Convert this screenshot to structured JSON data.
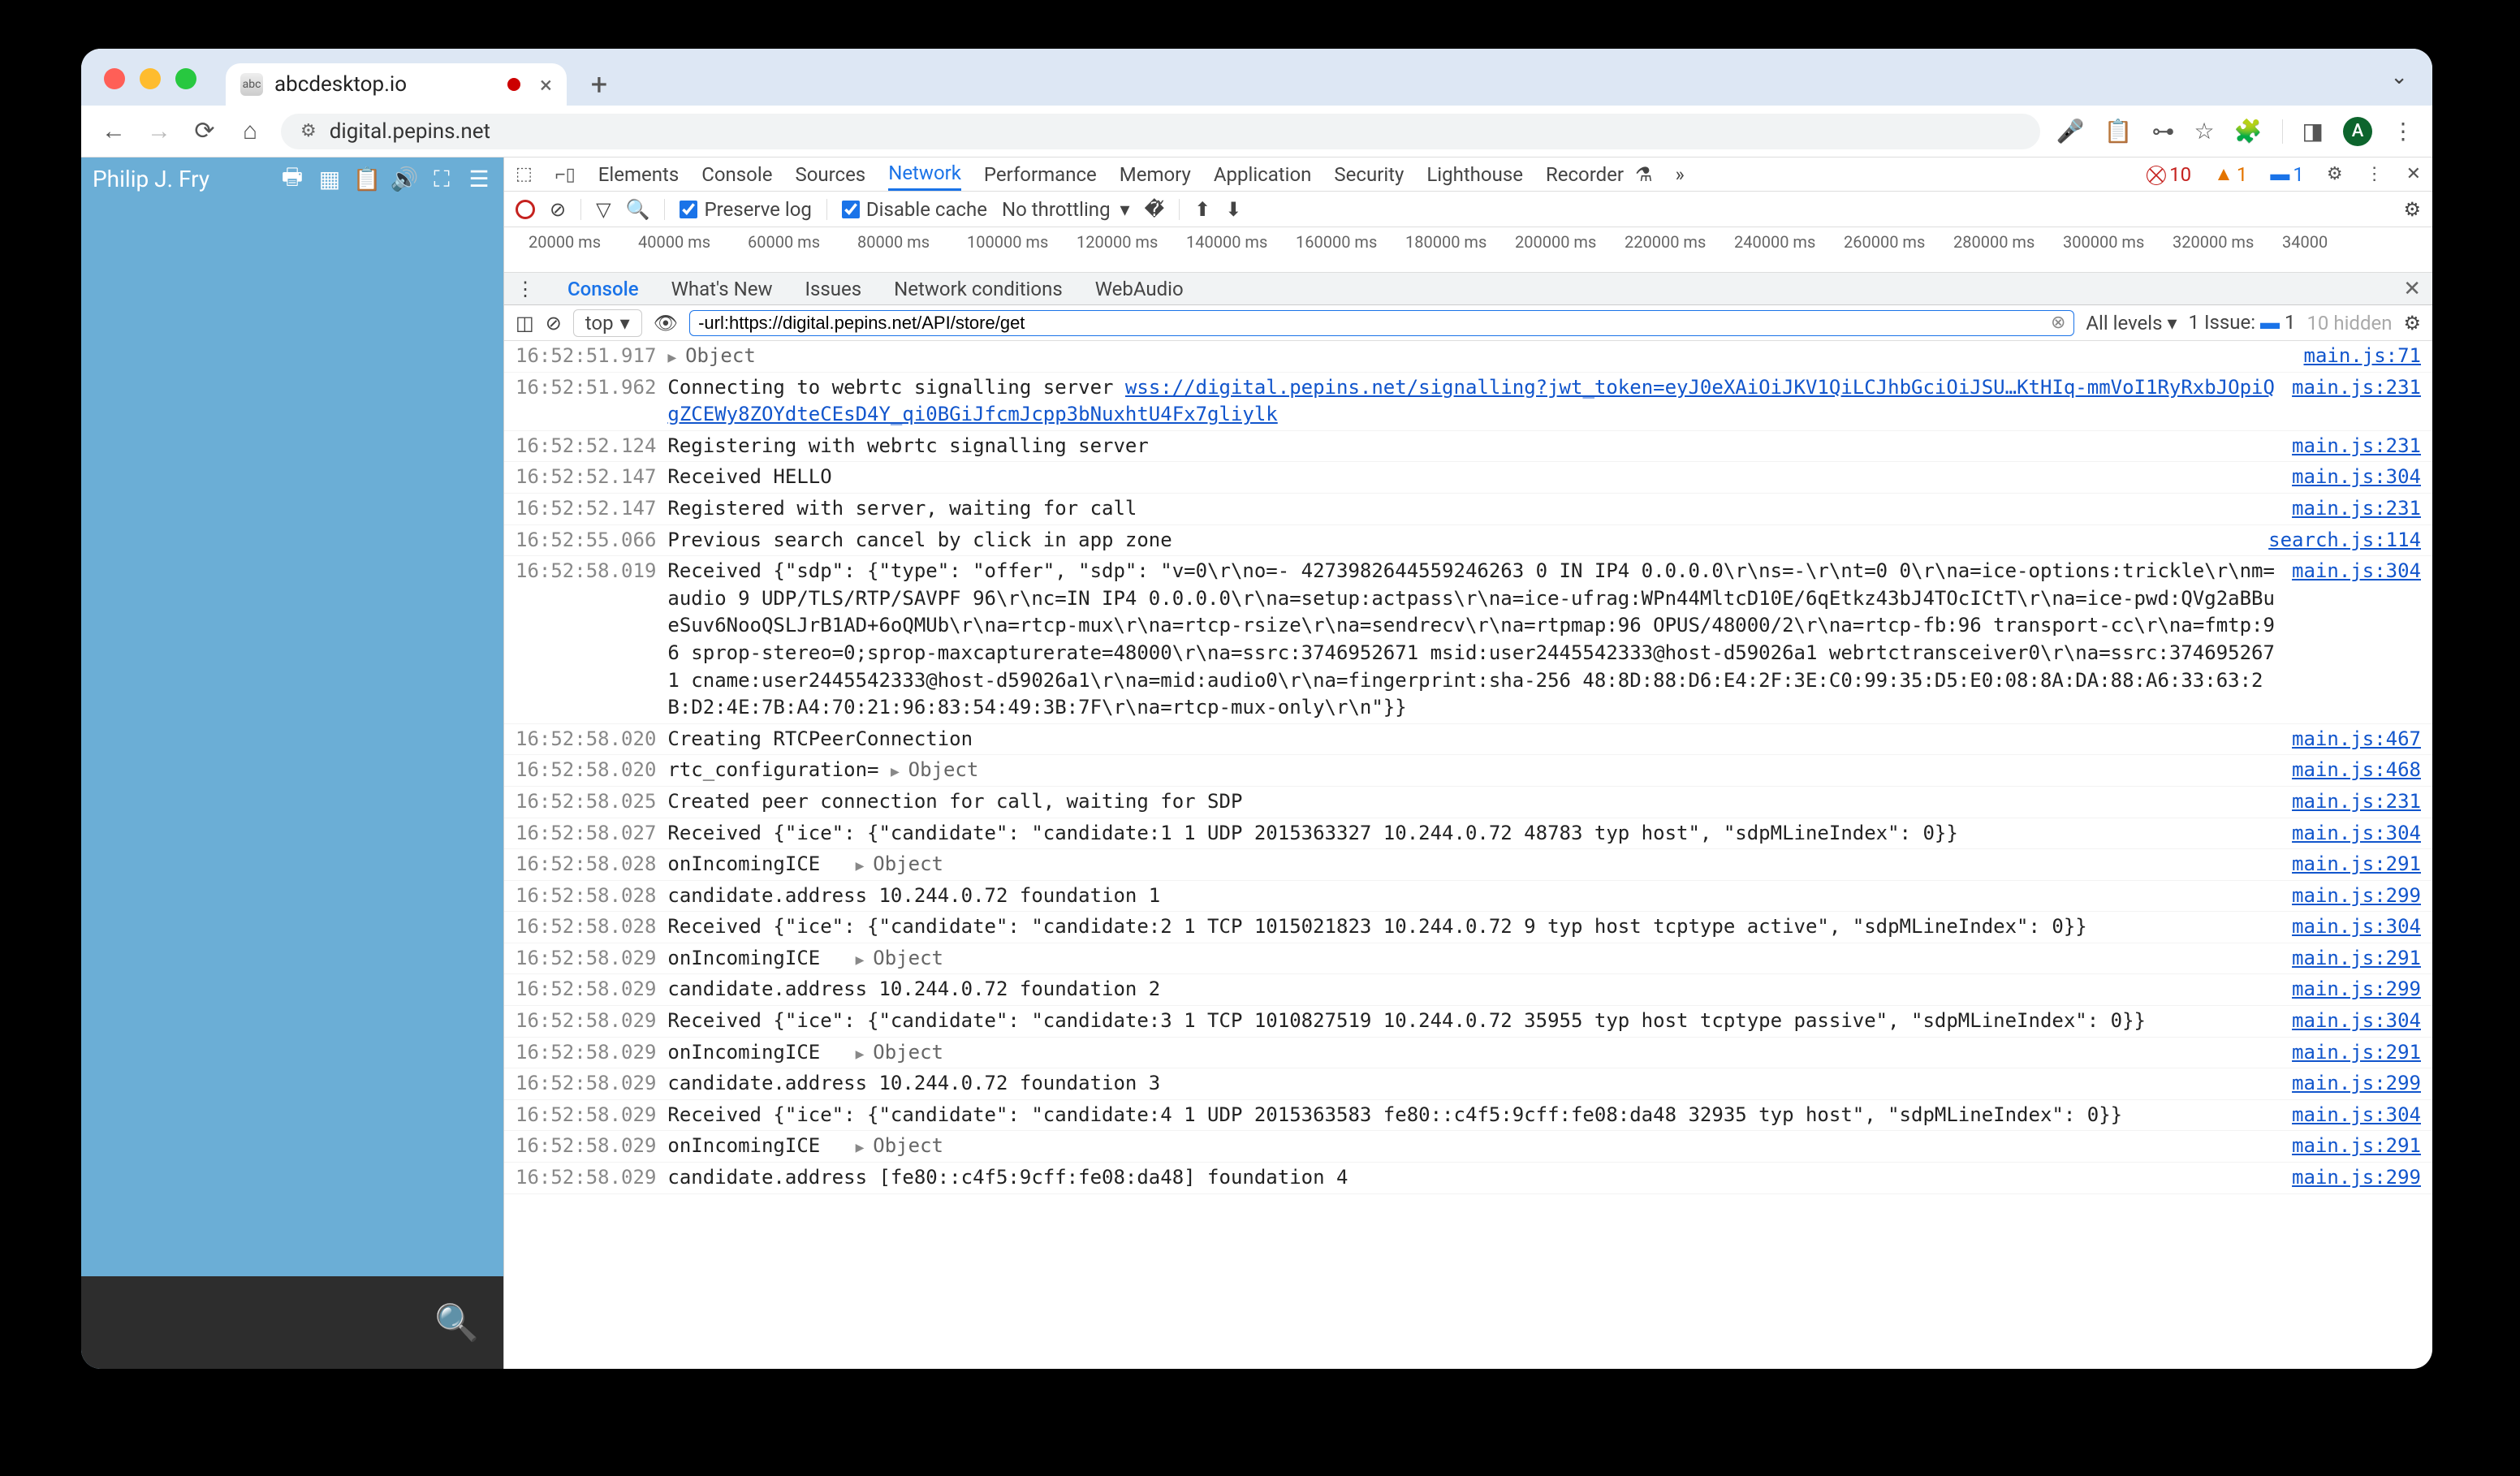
{
  "browser": {
    "tab_title": "abcdesktop.io",
    "url": "digital.pepins.net",
    "avatar_letter": "A"
  },
  "app": {
    "user_name": "Philip J. Fry"
  },
  "devtools": {
    "tabs": [
      "Elements",
      "Console",
      "Sources",
      "Network",
      "Performance",
      "Memory",
      "Application",
      "Security",
      "Lighthouse",
      "Recorder"
    ],
    "active_tab": "Network",
    "errors": "10",
    "warnings": "1",
    "infos": "1"
  },
  "network_toolbar": {
    "preserve_log": "Preserve log",
    "disable_cache": "Disable cache",
    "throttling": "No throttling"
  },
  "timeline_ticks": [
    "20000 ms",
    "40000 ms",
    "60000 ms",
    "80000 ms",
    "100000 ms",
    "120000 ms",
    "140000 ms",
    "160000 ms",
    "180000 ms",
    "200000 ms",
    "220000 ms",
    "240000 ms",
    "260000 ms",
    "280000 ms",
    "300000 ms",
    "320000 ms",
    "34000"
  ],
  "drawer": {
    "tabs": [
      "Console",
      "What's New",
      "Issues",
      "Network conditions",
      "WebAudio"
    ],
    "active": "Console"
  },
  "console_toolbar": {
    "context": "top",
    "filter_value": "-url:https://digital.pepins.net/API/store/get",
    "levels": "All levels",
    "issues_label": "1 Issue:",
    "issues_count": "1",
    "hidden": "10 hidden"
  },
  "logs": [
    {
      "ts": "16:52:51.917",
      "msg_parts": [
        {
          "type": "obj",
          "text": "Object"
        }
      ],
      "src": "main.js:71"
    },
    {
      "ts": "16:52:51.962",
      "msg_parts": [
        {
          "type": "text",
          "text": "Connecting to webrtc signalling server "
        },
        {
          "type": "link",
          "text": "wss://digital.pepins.net/signalling?jwt_token=eyJ0eXAiOiJKV1QiLCJhbGciOiJSU…KtHIq-mmVoI1RyRxbJOpiQgZCEWy8ZOYdteCEsD4Y_qi0BGiJfcmJcpp3bNuxhtU4Fx7gliylk"
        }
      ],
      "src": "main.js:231"
    },
    {
      "ts": "16:52:52.124",
      "msg_parts": [
        {
          "type": "text",
          "text": "Registering with webrtc signalling server"
        }
      ],
      "src": "main.js:231"
    },
    {
      "ts": "16:52:52.147",
      "msg_parts": [
        {
          "type": "text",
          "text": "Received HELLO"
        }
      ],
      "src": "main.js:304"
    },
    {
      "ts": "16:52:52.147",
      "msg_parts": [
        {
          "type": "text",
          "text": "Registered with server, waiting for call"
        }
      ],
      "src": "main.js:231"
    },
    {
      "ts": "16:52:55.066",
      "msg_parts": [
        {
          "type": "text",
          "text": "Previous search cancel by click in app zone"
        }
      ],
      "src": "search.js:114"
    },
    {
      "ts": "16:52:58.019",
      "msg_parts": [
        {
          "type": "text",
          "text": "Received {\"sdp\": {\"type\": \"offer\", \"sdp\": \"v=0\\r\\no=- 4273982644559246263 0 IN IP4 0.0.0.0\\r\\ns=-\\r\\nt=0 0\\r\\na=ice-options:trickle\\r\\nm=audio 9 UDP/TLS/RTP/SAVPF 96\\r\\nc=IN IP4 0.0.0.0\\r\\na=setup:actpass\\r\\na=ice-ufrag:WPn44MltcD10E/6qEtkz43bJ4TOcICtT\\r\\na=ice-pwd:QVg2aBBueSuv6NooQSLJrB1AD+6oQMUb\\r\\na=rtcp-mux\\r\\na=rtcp-rsize\\r\\na=sendrecv\\r\\na=rtpmap:96 OPUS/48000/2\\r\\na=rtcp-fb:96 transport-cc\\r\\na=fmtp:96 sprop-stereo=0;sprop-maxcapturerate=48000\\r\\na=ssrc:3746952671 msid:user2445542333@host-d59026a1 webrtctransceiver0\\r\\na=ssrc:3746952671 cname:user2445542333@host-d59026a1\\r\\na=mid:audio0\\r\\na=fingerprint:sha-256 48:8D:88:D6:E4:2F:3E:C0:99:35:D5:E0:08:8A:DA:88:A6:33:63:2B:D2:4E:7B:A4:70:21:96:83:54:49:3B:7F\\r\\na=rtcp-mux-only\\r\\n\"}}"
        }
      ],
      "src": "main.js:304"
    },
    {
      "ts": "16:52:58.020",
      "msg_parts": [
        {
          "type": "text",
          "text": "Creating RTCPeerConnection"
        }
      ],
      "src": "main.js:467"
    },
    {
      "ts": "16:52:58.020",
      "msg_parts": [
        {
          "type": "text",
          "text": "rtc_configuration= "
        },
        {
          "type": "obj",
          "text": "Object"
        }
      ],
      "src": "main.js:468"
    },
    {
      "ts": "16:52:58.025",
      "msg_parts": [
        {
          "type": "text",
          "text": "Created peer connection for call, waiting for SDP"
        }
      ],
      "src": "main.js:231"
    },
    {
      "ts": "16:52:58.027",
      "msg_parts": [
        {
          "type": "text",
          "text": "Received {\"ice\": {\"candidate\": \"candidate:1 1 UDP 2015363327 10.244.0.72 48783 typ host\", \"sdpMLineIndex\": 0}}"
        }
      ],
      "src": "main.js:304"
    },
    {
      "ts": "16:52:58.028",
      "msg_parts": [
        {
          "type": "text",
          "text": "onIncomingICE   "
        },
        {
          "type": "obj",
          "text": "Object"
        }
      ],
      "src": "main.js:291"
    },
    {
      "ts": "16:52:58.028",
      "msg_parts": [
        {
          "type": "text",
          "text": "candidate.address 10.244.0.72 foundation 1"
        }
      ],
      "src": "main.js:299"
    },
    {
      "ts": "16:52:58.028",
      "msg_parts": [
        {
          "type": "text",
          "text": "Received {\"ice\": {\"candidate\": \"candidate:2 1 TCP 1015021823 10.244.0.72 9 typ host tcptype active\", \"sdpMLineIndex\": 0}}"
        }
      ],
      "src": "main.js:304"
    },
    {
      "ts": "16:52:58.029",
      "msg_parts": [
        {
          "type": "text",
          "text": "onIncomingICE   "
        },
        {
          "type": "obj",
          "text": "Object"
        }
      ],
      "src": "main.js:291"
    },
    {
      "ts": "16:52:58.029",
      "msg_parts": [
        {
          "type": "text",
          "text": "candidate.address 10.244.0.72 foundation 2"
        }
      ],
      "src": "main.js:299"
    },
    {
      "ts": "16:52:58.029",
      "msg_parts": [
        {
          "type": "text",
          "text": "Received {\"ice\": {\"candidate\": \"candidate:3 1 TCP 1010827519 10.244.0.72 35955 typ host tcptype passive\", \"sdpMLineIndex\": 0}}"
        }
      ],
      "src": "main.js:304"
    },
    {
      "ts": "16:52:58.029",
      "msg_parts": [
        {
          "type": "text",
          "text": "onIncomingICE   "
        },
        {
          "type": "obj",
          "text": "Object"
        }
      ],
      "src": "main.js:291"
    },
    {
      "ts": "16:52:58.029",
      "msg_parts": [
        {
          "type": "text",
          "text": "candidate.address 10.244.0.72 foundation 3"
        }
      ],
      "src": "main.js:299"
    },
    {
      "ts": "16:52:58.029",
      "msg_parts": [
        {
          "type": "text",
          "text": "Received {\"ice\": {\"candidate\": \"candidate:4 1 UDP 2015363583 fe80::c4f5:9cff:fe08:da48 32935 typ host\", \"sdpMLineIndex\": 0}}"
        }
      ],
      "src": "main.js:304"
    },
    {
      "ts": "16:52:58.029",
      "msg_parts": [
        {
          "type": "text",
          "text": "onIncomingICE   "
        },
        {
          "type": "obj",
          "text": "Object"
        }
      ],
      "src": "main.js:291"
    },
    {
      "ts": "16:52:58.029",
      "msg_parts": [
        {
          "type": "text",
          "text": "candidate.address [fe80::c4f5:9cff:fe08:da48] foundation 4"
        }
      ],
      "src": "main.js:299"
    }
  ]
}
